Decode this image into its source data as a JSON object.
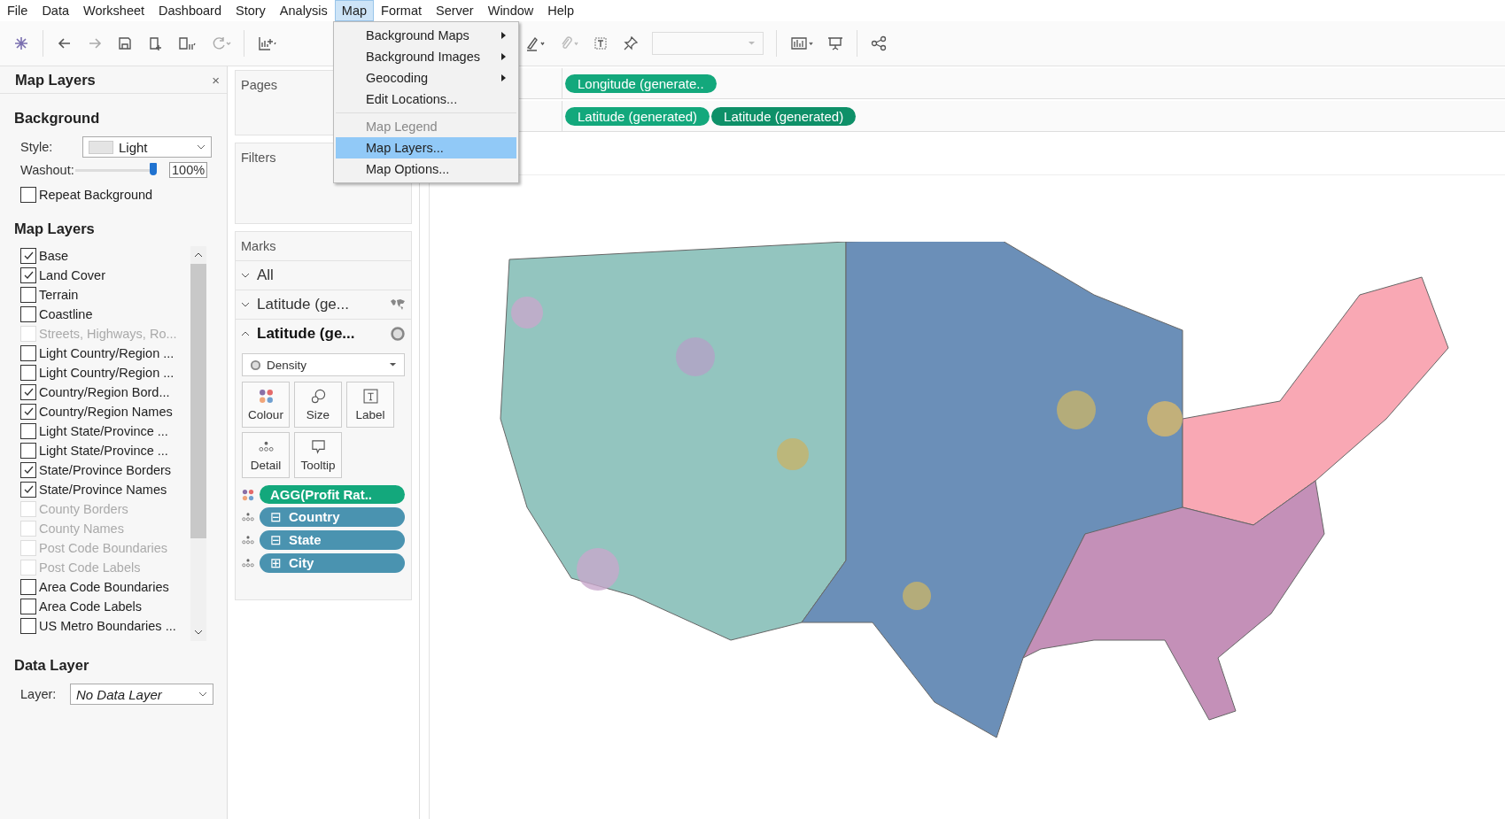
{
  "menu_bar": [
    {
      "label": "File",
      "selected": false
    },
    {
      "label": "Data",
      "selected": false
    },
    {
      "label": "Worksheet",
      "selected": false
    },
    {
      "label": "Dashboard",
      "selected": false
    },
    {
      "label": "Story",
      "selected": false
    },
    {
      "label": "Analysis",
      "selected": false
    },
    {
      "label": "Map",
      "selected": true
    },
    {
      "label": "Format",
      "selected": false
    },
    {
      "label": "Server",
      "selected": false
    },
    {
      "label": "Window",
      "selected": false
    },
    {
      "label": "Help",
      "selected": false
    }
  ],
  "dropdown": {
    "groups": [
      [
        {
          "label": "Background Maps",
          "submenu": true,
          "disabled": false,
          "selected": false
        },
        {
          "label": "Background Images",
          "submenu": true,
          "disabled": false,
          "selected": false
        },
        {
          "label": "Geocoding",
          "submenu": true,
          "disabled": false,
          "selected": false
        },
        {
          "label": "Edit Locations...",
          "submenu": false,
          "disabled": false,
          "selected": false
        }
      ],
      [
        {
          "label": "Map Legend",
          "submenu": false,
          "disabled": true,
          "selected": false
        },
        {
          "label": "Map Layers...",
          "submenu": false,
          "disabled": false,
          "selected": true
        },
        {
          "label": "Map Options...",
          "submenu": false,
          "disabled": false,
          "selected": false
        }
      ]
    ]
  },
  "left_panel": {
    "title": "Map Layers",
    "close": "×",
    "background": {
      "heading": "Background",
      "style_label": "Style:",
      "style_value": "Light",
      "washout_label": "Washout:",
      "washout": {
        "level": 1
      },
      "washout_reading": "100%",
      "repeat": {
        "label": "Repeat Background",
        "checked": false
      }
    },
    "layers_heading": "Map Layers",
    "layers": [
      {
        "label": "Base",
        "checked": true,
        "disabled": false
      },
      {
        "label": "Land Cover",
        "checked": true,
        "disabled": false
      },
      {
        "label": "Terrain",
        "checked": false,
        "disabled": false
      },
      {
        "label": "Coastline",
        "checked": false,
        "disabled": false
      },
      {
        "label": "Streets, Highways, Ro...",
        "checked": false,
        "disabled": true
      },
      {
        "label": "Light Country/Region ...",
        "checked": false,
        "disabled": false
      },
      {
        "label": "Light Country/Region ...",
        "checked": false,
        "disabled": false
      },
      {
        "label": "Country/Region Bord...",
        "checked": true,
        "disabled": false
      },
      {
        "label": "Country/Region Names",
        "checked": true,
        "disabled": false
      },
      {
        "label": "Light State/Province ...",
        "checked": false,
        "disabled": false
      },
      {
        "label": "Light State/Province ...",
        "checked": false,
        "disabled": false
      },
      {
        "label": "State/Province Borders",
        "checked": true,
        "disabled": false
      },
      {
        "label": "State/Province Names",
        "checked": true,
        "disabled": false
      },
      {
        "label": "County Borders",
        "checked": false,
        "disabled": true
      },
      {
        "label": "County Names",
        "checked": false,
        "disabled": true
      },
      {
        "label": "Post Code Boundaries",
        "checked": false,
        "disabled": true
      },
      {
        "label": "Post Code Labels",
        "checked": false,
        "disabled": true
      },
      {
        "label": "Area Code Boundaries",
        "checked": false,
        "disabled": false
      },
      {
        "label": "Area Code Labels",
        "checked": false,
        "disabled": false
      },
      {
        "label": "US Metro Boundaries ...",
        "checked": false,
        "disabled": false
      }
    ],
    "data_layer": {
      "heading": "Data Layer",
      "label": "Layer:",
      "value": "No Data Layer"
    }
  },
  "shelves": {
    "pages": "Pages",
    "filters": "Filters",
    "marks": {
      "title": "Marks",
      "cards": [
        {
          "label": "All",
          "expanded": false,
          "kind": "all"
        },
        {
          "label": "Latitude (ge...",
          "expanded": false,
          "kind": "map"
        },
        {
          "label": "Latitude (ge...",
          "expanded": true,
          "kind": "density"
        }
      ],
      "mark_type": "Density",
      "buttons": [
        {
          "label": "Colour",
          "kind": "colour"
        },
        {
          "label": "Size",
          "kind": "size"
        },
        {
          "label": "Label",
          "kind": "label"
        },
        {
          "label": "Detail",
          "kind": "detail"
        },
        {
          "label": "Tooltip",
          "kind": "tooltip"
        }
      ],
      "pills": [
        {
          "label": "AGG(Profit Rat..",
          "kind": "colour",
          "color": "#13a87c"
        },
        {
          "label": "Country",
          "toggle": "⊟",
          "kind": "detail",
          "color": "#4a93b0"
        },
        {
          "label": "State",
          "toggle": "⊟",
          "kind": "detail",
          "color": "#4a93b0"
        },
        {
          "label": "City",
          "toggle": "⊞",
          "kind": "detail",
          "color": "#4a93b0"
        }
      ]
    }
  },
  "columns_shelf": [
    {
      "label": "Longitude (generate..",
      "color": "#13a87c"
    }
  ],
  "rows_shelf": [
    {
      "label": "Latitude (generated)",
      "color": "#13a87c"
    },
    {
      "label": "Latitude (generated)",
      "color": "#0e9068"
    }
  ]
}
